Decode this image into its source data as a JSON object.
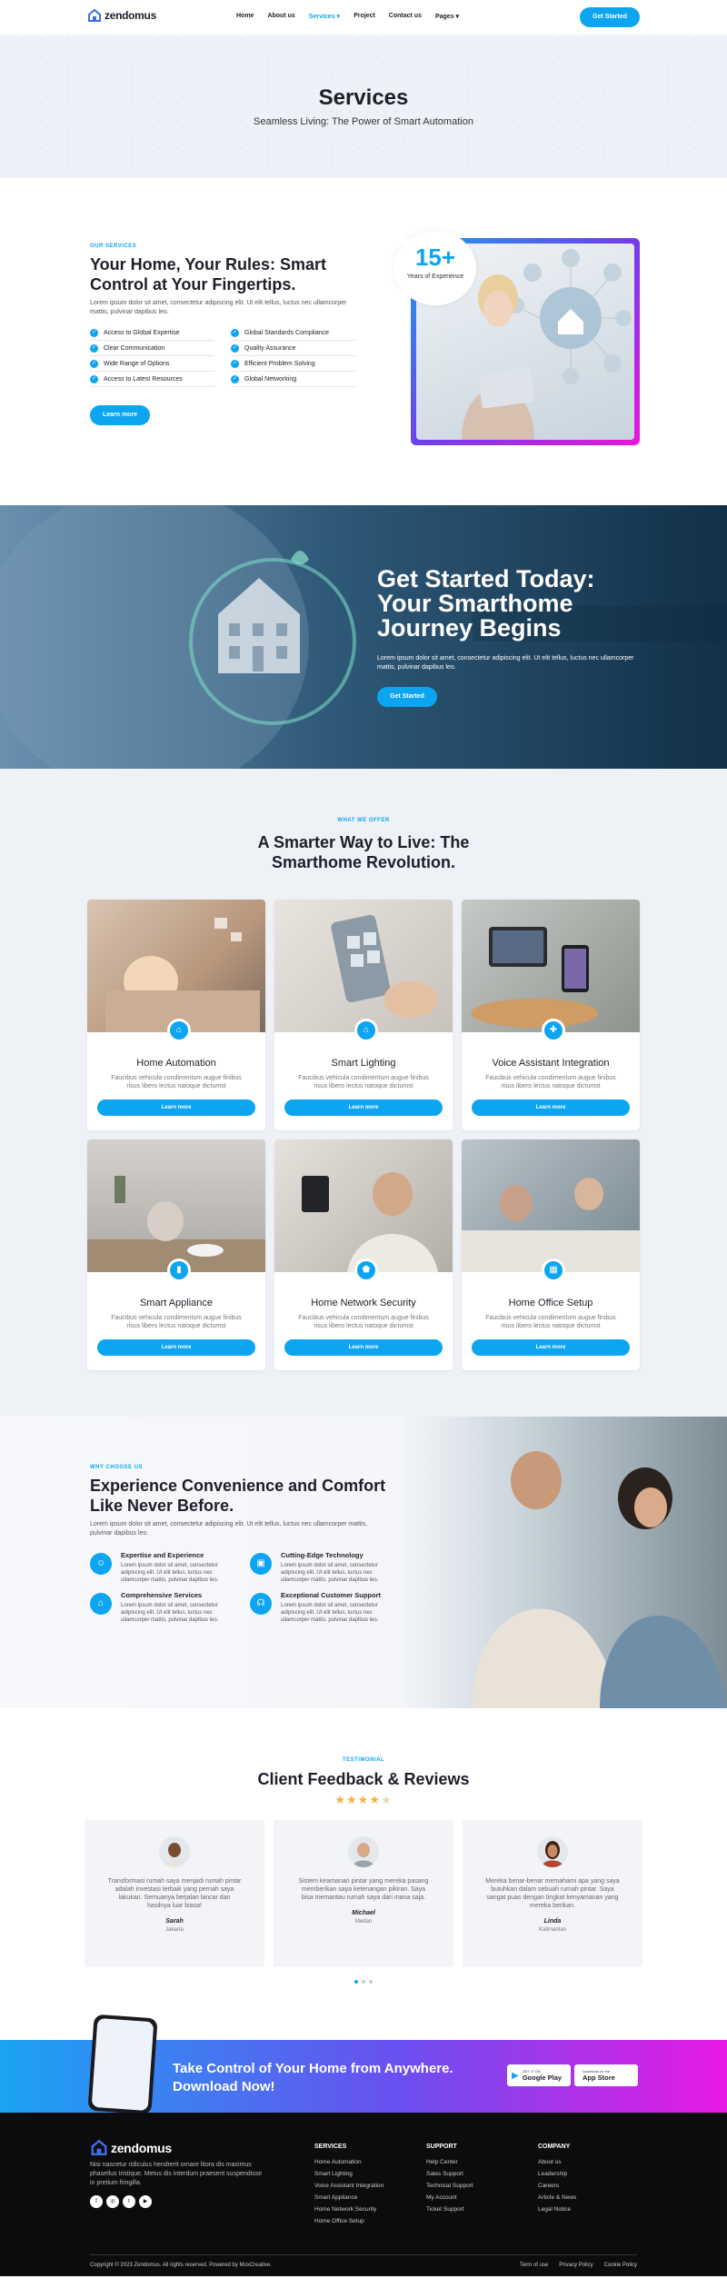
{
  "header": {
    "logo": "zendomus",
    "nav": [
      {
        "label": "Home",
        "active": false
      },
      {
        "label": "About us",
        "active": false
      },
      {
        "label": "Services",
        "active": true,
        "dropdown": true
      },
      {
        "label": "Project",
        "active": false
      },
      {
        "label": "Contact us",
        "active": false
      },
      {
        "label": "Pages",
        "active": false,
        "dropdown": true
      }
    ],
    "cta": "Get Started"
  },
  "hero": {
    "title": "Services",
    "subtitle": "Seamless Living: The Power of Smart Automation"
  },
  "about": {
    "eyebrow": "OUR SERVICES",
    "title": "Your Home, Your Rules: Smart Control at Your Fingertips.",
    "lead": "Lorem ipsum dolor sit amet, consectetur adipiscing elit. Ut elit tellus, luctus nec ullamcorper mattis, pulvinar dapibus leo.",
    "features": [
      "Access to Global Expertise",
      "Global Standards Compliance",
      "Clear Communication",
      "Quality Assurance",
      "Wide Range of Options",
      "Efficient Problem Solving",
      "Access to Latest Resources",
      "Global Networking"
    ],
    "button": "Learn more",
    "badge_number": "15+",
    "badge_text": "Years of Experience"
  },
  "cta1": {
    "title": "Get Started Today: Your Smarthome Journey Begins",
    "text": "Lorem ipsum dolor sit amet, consectetur adipiscing elit. Ut elit tellus, luctus nec ullamcorper mattis, pulvinar dapibus leo.",
    "button": "Get Started"
  },
  "services": {
    "eyebrow": "WHAT WE OFFER",
    "title": "A Smarter Way to Live: The Smarthome Revolution.",
    "cards": [
      {
        "title": "Home Automation",
        "text": "Faucibus vehicula condimentum augue finibus risus libero lectus natoque dictumst",
        "button": "Learn more",
        "icon": "home-automation-icon"
      },
      {
        "title": "Smart Lighting",
        "text": "Faucibus vehicula condimentum augue finibus risus libero lectus natoque dictumst",
        "button": "Learn more",
        "icon": "lighting-icon"
      },
      {
        "title": "Voice Assistant Integration",
        "text": "Faucibus vehicula condimentum augue finibus risus libero lectus natoque dictumst",
        "button": "Learn more",
        "icon": "voice-icon"
      },
      {
        "title": "Smart Appliance",
        "text": "Faucibus vehicula condimentum augue finibus risus libero lectus natoque dictumst",
        "button": "Learn more",
        "icon": "appliance-icon"
      },
      {
        "title": "Home Network Security",
        "text": "Faucibus vehicula condimentum augue finibus risus libero lectus natoque dictumst",
        "button": "Learn more",
        "icon": "shield-icon"
      },
      {
        "title": "Home Office Setup",
        "text": "Faucibus vehicula condimentum augue finibus risus libero lectus natoque dictumst",
        "button": "Learn more",
        "icon": "office-icon"
      }
    ]
  },
  "why": {
    "eyebrow": "WHY CHOOSE US",
    "title": "Experience Convenience and Comfort Like Never Before.",
    "lead": "Lorem ipsum dolor sit amet, consectetur adipiscing elit. Ut elit tellus, luctus nec ullamcorper mattis, pulvinar dapibus leo.",
    "items": [
      {
        "title": "Expertise and Experience",
        "text": "Lorem ipsum dolor sit amet, consectetur adipiscing elit. Ut elit tellus, luctus nec ullamcorper mattis, pulvinar dapibus leo."
      },
      {
        "title": "Cutting-Edge Technology",
        "text": "Lorem ipsum dolor sit amet, consectetur adipiscing elit. Ut elit tellus, luctus nec ullamcorper mattis, pulvinar dapibus leo."
      },
      {
        "title": "Comprehensive Services",
        "text": "Lorem ipsum dolor sit amet, consectetur adipiscing elit. Ut elit tellus, luctus nec ullamcorper mattis, pulvinar dapibus leo."
      },
      {
        "title": "Exceptional Customer Support",
        "text": "Lorem ipsum dolor sit amet, consectetur adipiscing elit. Ut elit tellus, luctus nec ullamcorper mattis, pulvinar dapibus leo."
      }
    ]
  },
  "testimonial": {
    "eyebrow": "TESTIMONIAL",
    "title": "Client Feedback & Reviews",
    "rating": 4.5,
    "items": [
      {
        "text": "Transformasi rumah saya menjadi rumah pintar adalah investasi terbaik yang pernah saya lakukan. Semuanya berjalan lancar dan hasilnya luar biasa!",
        "name": "Sarah",
        "city": "Jakarta"
      },
      {
        "text": "Sistem keamanan pintar yang mereka pasang memberikan saya ketenangan pikiran. Saya bisa memantau rumah saya dari mana saja.",
        "name": "Michael",
        "city": "Medan"
      },
      {
        "text": "Mereka benar-benar memahami apa yang saya butuhkan dalam sebuah rumah pintar. Saya sangat puas dengan tingkat kenyamanan yang mereka berikan.",
        "name": "Linda",
        "city": "Kalimantan"
      }
    ]
  },
  "app": {
    "title": "Take Control of Your Home from Anywhere. Download Now!",
    "google_small": "GET IT ON",
    "google": "Google Play",
    "apple_small": "Download on the",
    "apple": "App Store"
  },
  "footer": {
    "logo": "zendomus",
    "desc": "Nisi nascetur ridiculus hendrerit ornare litora dis maximus phasellus tristique. Metus dis interdum praesent suspendisse in pretium fringilla.",
    "columns": [
      {
        "title": "SERVICES",
        "links": [
          "Home Automation",
          "Smart Lighting",
          "Voice Assistant Integration",
          "Smart Appliance",
          "Home Network Security",
          "Home Office Setup"
        ]
      },
      {
        "title": "SUPPORT",
        "links": [
          "Help Center",
          "Sales Support",
          "Technical Support",
          "My Account",
          "Ticket Support"
        ]
      },
      {
        "title": "COMPANY",
        "links": [
          "About us",
          "Leadership",
          "Careers",
          "Article & News",
          "Legal Notice"
        ]
      }
    ],
    "copyright": "Copyright © 2023 Zendomus. All rights reserved. Powered by MoxCreative.",
    "bottom_links": [
      "Term of use",
      "Privacy Policy",
      "Cookie Policy"
    ]
  },
  "colors": {
    "accent": "#0ea5f0",
    "dark": "#0c0c0f",
    "star": "#f3b33e"
  }
}
